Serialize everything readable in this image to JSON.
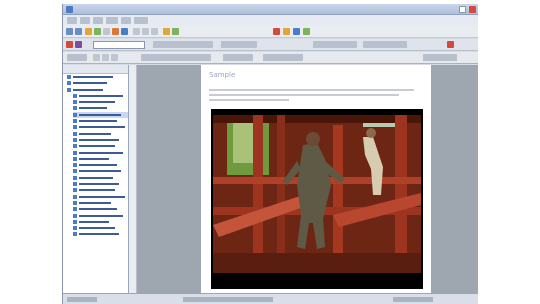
{
  "colors": {
    "titlebar": "#aebfd9",
    "sidebar_link": "#3d5c94",
    "video_bg": "#000000",
    "beam_red": "#8a2e1c",
    "greenery": "#6f9a3d"
  },
  "sidebar": {
    "item_count": 26
  },
  "document": {
    "heading": "Sample"
  },
  "video": {
    "scene": "person-climbing-red-scaffolding"
  }
}
